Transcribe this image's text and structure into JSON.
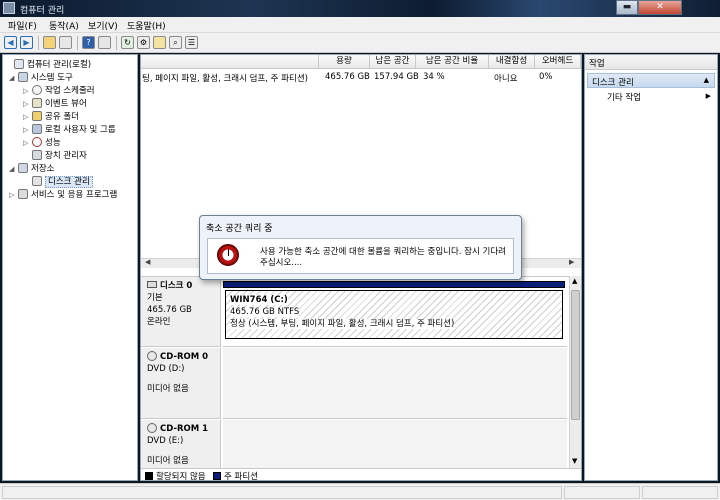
{
  "window": {
    "title": "컴퓨터 관리",
    "minimize": "▬",
    "close": "✕"
  },
  "menu": [
    "파일(F)",
    "동작(A)",
    "보기(V)",
    "도움말(H)"
  ],
  "tree": [
    {
      "label": "컴퓨터 관리(로컬)",
      "icon": "computer-management-icon",
      "arrow": ""
    },
    {
      "label": "시스템 도구",
      "icon": "system-tools-icon",
      "arrow": "◢"
    },
    {
      "label": "작업 스케줄러",
      "icon": "task-scheduler-icon",
      "arrow": "▷"
    },
    {
      "label": "이벤트 뷰어",
      "icon": "event-viewer-icon",
      "arrow": "▷"
    },
    {
      "label": "공유 폴더",
      "icon": "shared-folders-icon",
      "arrow": "▷"
    },
    {
      "label": "로컬 사용자 및 그룹",
      "icon": "local-users-icon",
      "arrow": "▷"
    },
    {
      "label": "성능",
      "icon": "performance-icon",
      "arrow": "▷"
    },
    {
      "label": "장치 관리자",
      "icon": "device-manager-icon",
      "arrow": ""
    },
    {
      "label": "저장소",
      "icon": "storage-icon",
      "arrow": "◢"
    },
    {
      "label": "디스크 관리",
      "icon": "disk-management-icon",
      "arrow": ""
    },
    {
      "label": "서비스 및 응용 프로그램",
      "icon": "services-icon",
      "arrow": "▷"
    }
  ],
  "volume_table": {
    "columns": [
      "용량",
      "남은 공간",
      "남은 공간 비율",
      "내결함성",
      "오버헤드"
    ],
    "row": {
      "type": "팅, 페이지 파일, 활성, 크래시 덤프, 주 파티션)",
      "capacity": "465.76 GB",
      "free": "157.94 GB",
      "free_pct": "34 %",
      "fault_tolerance": "아니요",
      "overhead": "0%"
    }
  },
  "disks": [
    {
      "name": "디스크 0",
      "type": "기본",
      "size": "465.76 GB",
      "status": "온라인",
      "partition": {
        "name": "WIN764  (C:)",
        "size": "465.76 GB NTFS",
        "status": "정상 (시스템, 부팅, 페이지 파일, 활성, 크래시 덤프, 주 파티션)"
      }
    },
    {
      "name": "CD-ROM 0",
      "drive": "DVD (D:)",
      "media": "미디어 없음"
    },
    {
      "name": "CD-ROM 1",
      "drive": "DVD (E:)",
      "media": "미디어 없음"
    }
  ],
  "legend": [
    {
      "label": "할당되지 않음",
      "color": "#000000"
    },
    {
      "label": "주 파티션",
      "color": "#0a1f7a"
    }
  ],
  "actions": {
    "title": "작업",
    "section": "디스크 관리",
    "more": "기타 작업"
  },
  "dialog": {
    "title": "축소 공간 쿼리 중",
    "message": "사용 가능한 축소 공간에 대한 볼륨을 쿼리하는 중입니다. 잠시 기다려 주십시오...."
  }
}
